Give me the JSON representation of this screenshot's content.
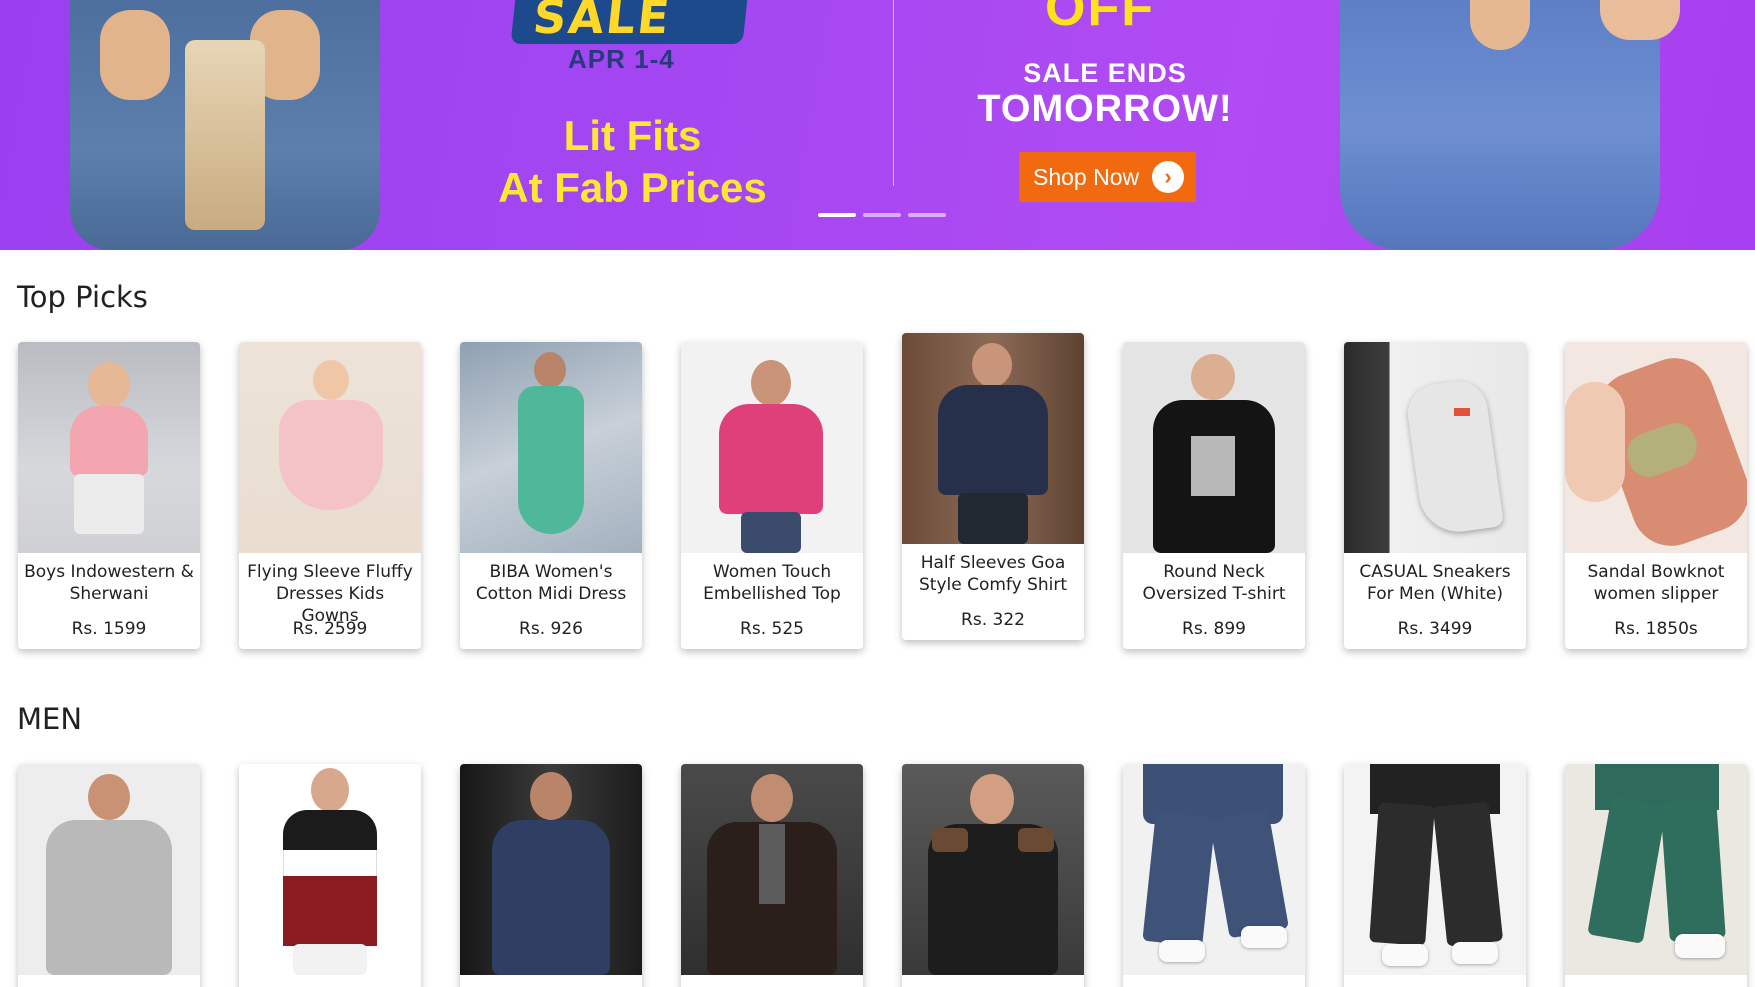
{
  "banner": {
    "sale_label": "SALE",
    "date": "APR 1-4",
    "tagline_line1": "Lit Fits",
    "tagline_line2": "At Fab Prices",
    "off_label": "OFF",
    "ends_line1": "SALE ENDS",
    "ends_line2": "TOMORROW!",
    "shop_now": "Shop Now",
    "arrow_icon": "chevron-right-icon",
    "carousel_count": 3,
    "carousel_active": 1,
    "colors": {
      "background": "#a447f2",
      "accent_yellow": "#ffe735",
      "button": "#f26a10"
    }
  },
  "top_picks": {
    "title": "Top Picks",
    "items": [
      {
        "name": "Boys Indowestern & Sherwani",
        "price": "Rs. 1599"
      },
      {
        "name": "Flying Sleeve Fluffy Dresses Kids Gowns",
        "price": "Rs. 2599"
      },
      {
        "name": "BIBA Women's Cotton Midi Dress",
        "price": "Rs. 926"
      },
      {
        "name": "Women Touch Embellished Top",
        "price": "Rs. 525"
      },
      {
        "name": "Half Sleeves Goa Style Comfy Shirt",
        "price": "Rs. 322"
      },
      {
        "name": "Round Neck Oversized T-shirt",
        "price": "Rs. 899"
      },
      {
        "name": "CASUAL Sneakers For Men (White)",
        "price": "Rs. 3499"
      },
      {
        "name": "Sandal Bowknot women slipper",
        "price": "Rs. 1850s"
      }
    ]
  },
  "men": {
    "title": "MEN",
    "item_count": 8
  }
}
